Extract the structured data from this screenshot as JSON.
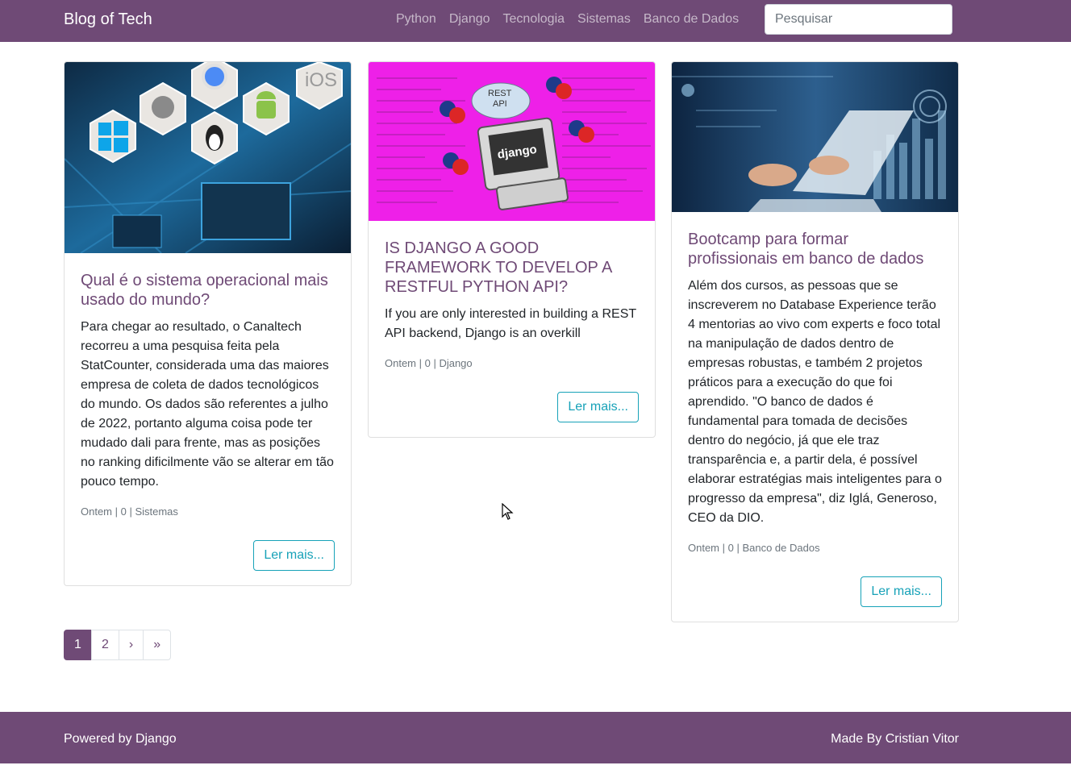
{
  "navbar": {
    "brand": "Blog of Tech",
    "links": [
      "Python",
      "Django",
      "Tecnologia",
      "Sistemas",
      "Banco de Dados"
    ],
    "search_placeholder": "Pesquisar"
  },
  "posts": [
    {
      "title": "Qual é o sistema operacional mais usado do mundo?",
      "excerpt": "Para chegar ao resultado, o Canaltech recorreu a uma pesquisa feita pela StatCounter, considerada uma das maiores empresa de coleta de dados tecnológicos do mundo. Os dados são referentes a julho de 2022, portanto alguma coisa pode ter mudado dali para frente, mas as posições no ranking dificilmente vão se alterar em tão pouco tempo.",
      "meta": "Ontem | 0 | Sistemas",
      "button": "Ler mais...",
      "image_labels": [
        "iOS"
      ]
    },
    {
      "title": "IS DJANGO A GOOD FRAMEWORK TO DEVELOP A RESTFUL PYTHON API?",
      "excerpt": "If you are only interested in building a REST API backend, Django is an overkill",
      "meta": "Ontem | 0 | Django",
      "button": "Ler mais...",
      "image_labels": [
        "REST",
        "API",
        "django"
      ]
    },
    {
      "title": "Bootcamp para formar profissionais em banco de dados",
      "excerpt": "Além dos cursos, as pessoas que se inscreverem no Database Experience terão 4 mentorias ao vivo com experts e foco total na manipulação de dados dentro de empresas robustas, e também 2 projetos práticos para a execução do que foi aprendido. \"O banco de dados é fundamental para tomada de decisões dentro do negócio, já que ele traz transparência e, a partir dela, é possível elaborar estratégias mais inteligentes para o progresso da empresa\", diz Iglá, Generoso, CEO da DIO.",
      "meta": "Ontem | 0 | Banco de Dados",
      "button": "Ler mais...",
      "image_labels": []
    }
  ],
  "pagination": {
    "pages": [
      "1",
      "2",
      "›",
      "»"
    ],
    "active": "1"
  },
  "footer": {
    "left": "Powered by Django",
    "right": "Made By Cristian Vitor"
  },
  "colors": {
    "brand": "#6f4a76",
    "button": "#17a2b8",
    "django_bg": "#ee20e8"
  }
}
